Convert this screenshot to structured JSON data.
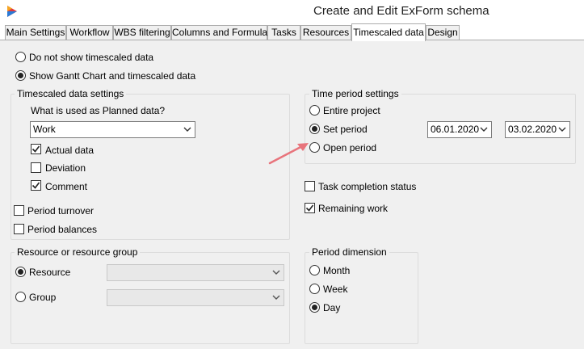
{
  "window": {
    "title": "Create and Edit ExForm schema"
  },
  "tabs": [
    {
      "label": "Main Settings"
    },
    {
      "label": "Workflow"
    },
    {
      "label": "WBS filtering"
    },
    {
      "label": "Columns and Formulas"
    },
    {
      "label": "Tasks"
    },
    {
      "label": "Resources"
    },
    {
      "label": "Timescaled data"
    },
    {
      "label": "Design"
    }
  ],
  "active_tab": "Timescaled data",
  "display_mode": {
    "no_timescaled_label": "Do not show timescaled data",
    "gantt_label": "Show Gantt Chart and timescaled data",
    "selected": "gantt"
  },
  "timescaled_settings": {
    "title": "Timescaled data settings",
    "planned_prompt": "What is used as Planned data?",
    "planned_value": "Work",
    "actual_label": "Actual data",
    "actual_checked": true,
    "deviation_label": "Deviation",
    "deviation_checked": false,
    "comment_label": "Comment",
    "comment_checked": true,
    "period_turnover_label": "Period turnover",
    "period_turnover_checked": false,
    "period_balances_label": "Period balances",
    "period_balances_checked": false
  },
  "time_period": {
    "title": "Time period settings",
    "entire_label": "Entire project",
    "set_label": "Set period",
    "open_label": "Open period",
    "selected": "set",
    "start_date": "06.01.2020",
    "end_date": "03.02.2020"
  },
  "task_completion": {
    "label": "Task completion status",
    "checked": false
  },
  "remaining_work": {
    "label": "Remaining work",
    "checked": true
  },
  "resource_group": {
    "title": "Resource or resource group",
    "resource_label": "Resource",
    "group_label": "Group",
    "selected": "resource",
    "resource_value": "",
    "group_value": ""
  },
  "period_dimension": {
    "title": "Period dimension",
    "month_label": "Month",
    "week_label": "Week",
    "day_label": "Day",
    "selected": "day"
  },
  "colors": {
    "annotation_arrow": "#e8747c",
    "logo_red": "#e03a3e",
    "logo_blue": "#2b7bd6"
  },
  "icons": {
    "logo": "app-logo-icon",
    "dropdown": "chevron-down-icon",
    "annotation": "arrow-annotation-icon"
  }
}
